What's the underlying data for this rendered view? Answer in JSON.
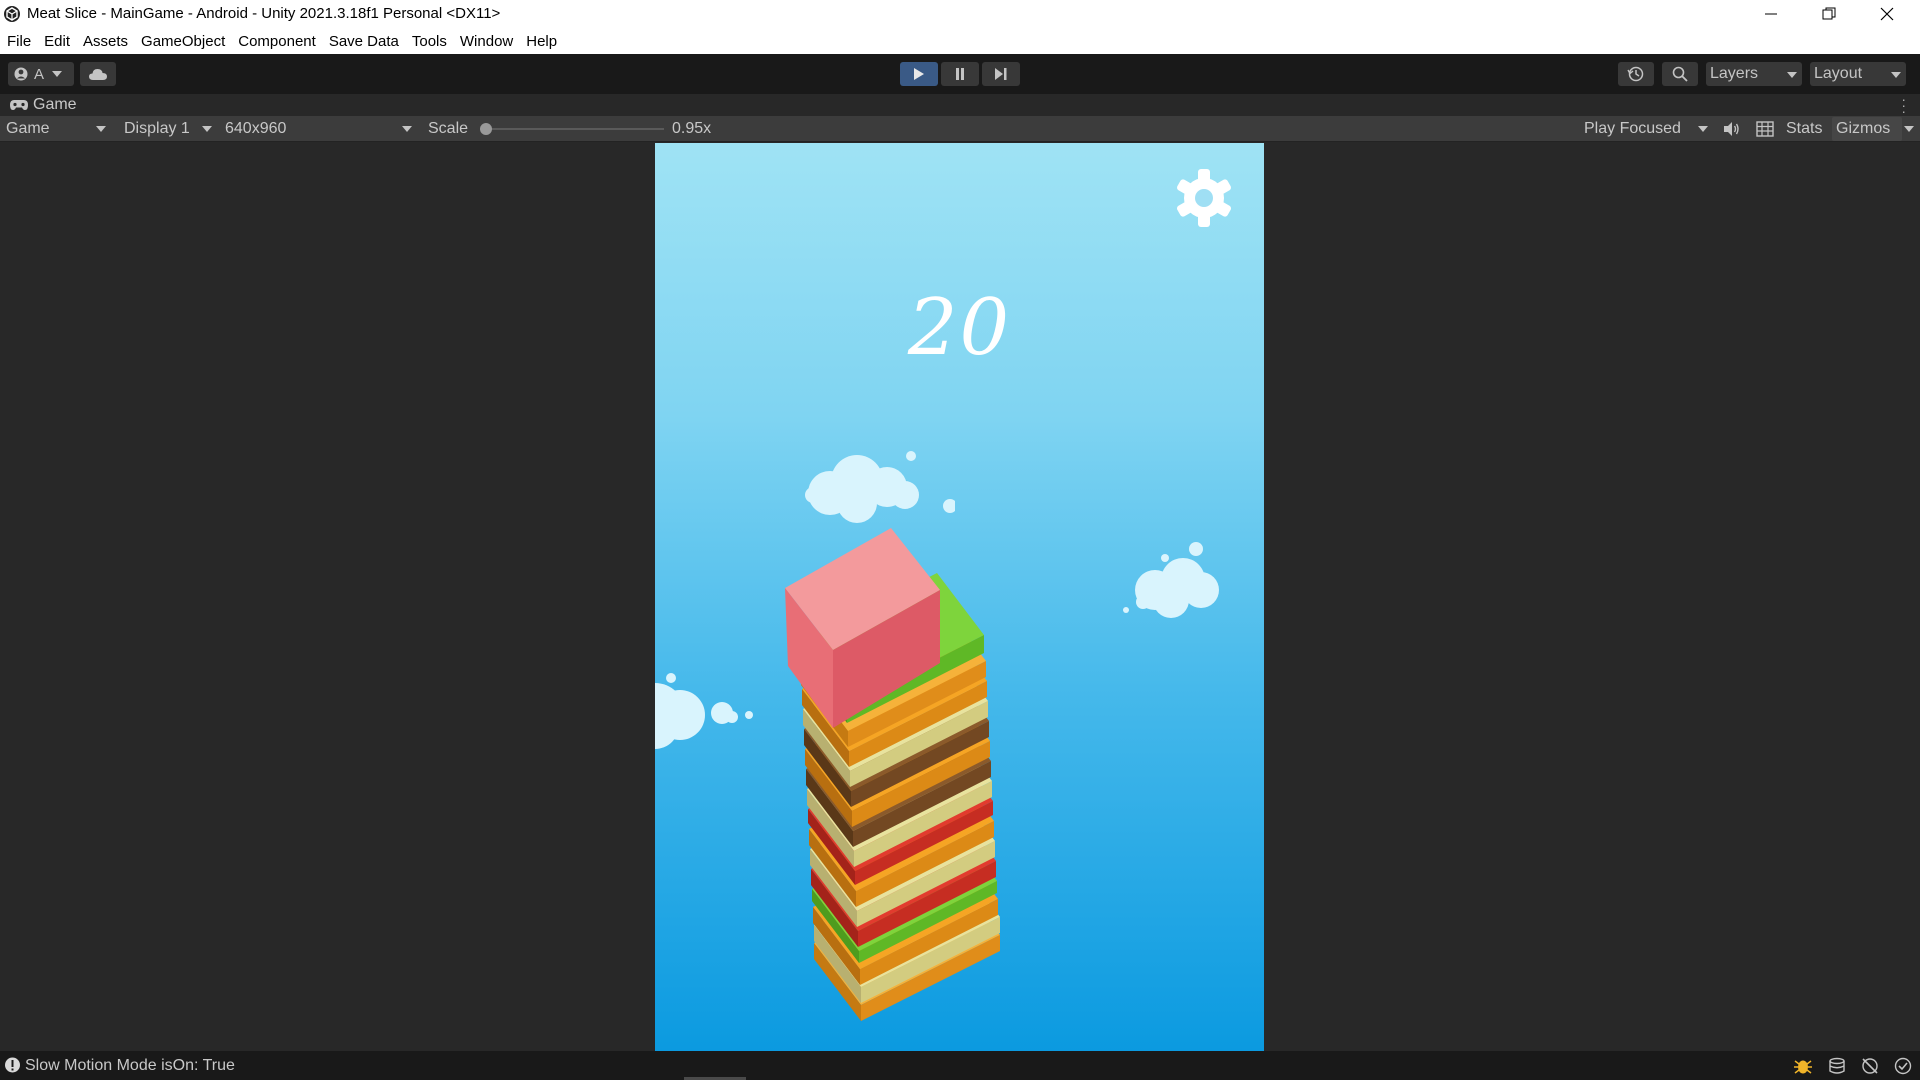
{
  "window": {
    "title": "Meat Slice - MainGame - Android - Unity 2021.3.18f1 Personal <DX11>",
    "minimize_icon": "minimize-icon",
    "restore_icon": "restore-icon",
    "close_icon": "close-icon"
  },
  "menu": {
    "items": [
      "File",
      "Edit",
      "Assets",
      "GameObject",
      "Component",
      "Save Data",
      "Tools",
      "Window",
      "Help"
    ]
  },
  "toolbar": {
    "account_label": "A",
    "layers_label": "Layers",
    "layout_label": "Layout",
    "play_active_color": "#3a5a86"
  },
  "tab": {
    "label": "Game",
    "icon": "gamepad-icon"
  },
  "game_view": {
    "mode": "Game",
    "display": "Display 1",
    "resolution": "640x960",
    "scale_label": "Scale",
    "scale_value": "0.95x",
    "scale_fraction": 0.0,
    "play_mode": "Play Focused",
    "stats_label": "Stats",
    "gizmos_label": "Gizmos"
  },
  "game": {
    "score": "20",
    "settings_icon": "gear-icon",
    "sky_top_color": "#9fe3f4",
    "sky_bottom_color": "#0b9ae0",
    "top_block_color": "#f07b80",
    "layer_colors": [
      "#7ed43c",
      "#f6a524",
      "#e8e39e",
      "#8b5a2b",
      "#e23b2e",
      "#f6a524"
    ]
  },
  "status": {
    "message": "Slow Motion Mode isOn: True"
  }
}
